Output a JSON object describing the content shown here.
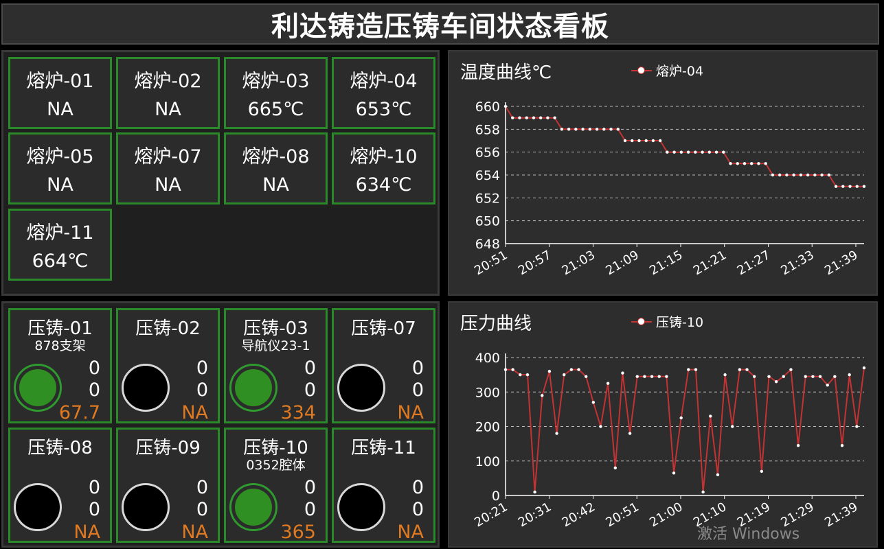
{
  "header": {
    "title": "利达铸造压铸车间状态看板"
  },
  "furnaces": [
    {
      "name": "熔炉-01",
      "value": "NA"
    },
    {
      "name": "熔炉-02",
      "value": "NA"
    },
    {
      "name": "熔炉-03",
      "value": "665℃"
    },
    {
      "name": "熔炉-04",
      "value": "653℃"
    },
    {
      "name": "熔炉-05",
      "value": "NA"
    },
    {
      "name": "熔炉-07",
      "value": "NA"
    },
    {
      "name": "熔炉-08",
      "value": "NA"
    },
    {
      "name": "熔炉-10",
      "value": "634℃"
    },
    {
      "name": "熔炉-11",
      "value": "664℃"
    }
  ],
  "die_casters": [
    {
      "name": "压铸-01",
      "part": "878支架",
      "running": true,
      "v1": "0",
      "v2": "0",
      "v3": "67.7"
    },
    {
      "name": "压铸-02",
      "part": "",
      "running": false,
      "v1": "0",
      "v2": "0",
      "v3": "NA"
    },
    {
      "name": "压铸-03",
      "part": "导航仪23-1",
      "running": true,
      "v1": "0",
      "v2": "0",
      "v3": "334"
    },
    {
      "name": "压铸-07",
      "part": "",
      "running": false,
      "v1": "0",
      "v2": "0",
      "v3": "NA"
    },
    {
      "name": "压铸-08",
      "part": "",
      "running": false,
      "v1": "0",
      "v2": "0",
      "v3": "NA"
    },
    {
      "name": "压铸-09",
      "part": "",
      "running": false,
      "v1": "0",
      "v2": "0",
      "v3": "NA"
    },
    {
      "name": "压铸-10",
      "part": "0352腔体",
      "running": true,
      "v1": "0",
      "v2": "0",
      "v3": "365"
    },
    {
      "name": "压铸-11",
      "part": "",
      "running": false,
      "v1": "0",
      "v2": "0",
      "v3": "NA"
    }
  ],
  "colors": {
    "running": "#2f8f22",
    "card_border": "#2a8a2a",
    "line": "#c33333",
    "accent_value": "#e07a22"
  },
  "watermark": "激活 Windows",
  "chart_data": [
    {
      "type": "line",
      "title": "温度曲线℃",
      "series": [
        {
          "name": "熔炉-04",
          "values": [
            660,
            659,
            659,
            659,
            659,
            659,
            659,
            659,
            658,
            658,
            658,
            658,
            658,
            658,
            658,
            658,
            658,
            657,
            657,
            657,
            657,
            657,
            657,
            656,
            656,
            656,
            656,
            656,
            656,
            656,
            656,
            656,
            655,
            655,
            655,
            655,
            655,
            655,
            654,
            654,
            654,
            654,
            654,
            654,
            654,
            654,
            654,
            653,
            653,
            653,
            653,
            653
          ]
        }
      ],
      "x_ticks": [
        "20:51",
        "20:57",
        "21:03",
        "21:09",
        "21:15",
        "21:21",
        "21:27",
        "21:33",
        "21:39"
      ],
      "y_ticks": [
        648,
        650,
        652,
        654,
        656,
        658,
        660
      ],
      "ylim": [
        648,
        660
      ],
      "grid": "horizontal-dashed",
      "legend": "top"
    },
    {
      "type": "line",
      "title": "压力曲线",
      "series": [
        {
          "name": "压铸-10",
          "values": [
            365,
            365,
            350,
            350,
            10,
            290,
            360,
            180,
            350,
            365,
            365,
            345,
            270,
            200,
            325,
            80,
            355,
            180,
            345,
            345,
            345,
            345,
            345,
            65,
            225,
            365,
            365,
            10,
            230,
            60,
            350,
            200,
            365,
            365,
            345,
            70,
            345,
            330,
            345,
            365,
            145,
            345,
            345,
            345,
            320,
            345,
            145,
            350,
            200,
            370
          ]
        }
      ],
      "x_ticks": [
        "20:21",
        "20:31",
        "20:42",
        "20:51",
        "21:00",
        "21:10",
        "21:19",
        "21:29",
        "21:39"
      ],
      "y_ticks": [
        0,
        100,
        200,
        300,
        400
      ],
      "ylim": [
        0,
        400
      ],
      "grid": "horizontal-dashed",
      "legend": "top"
    }
  ]
}
